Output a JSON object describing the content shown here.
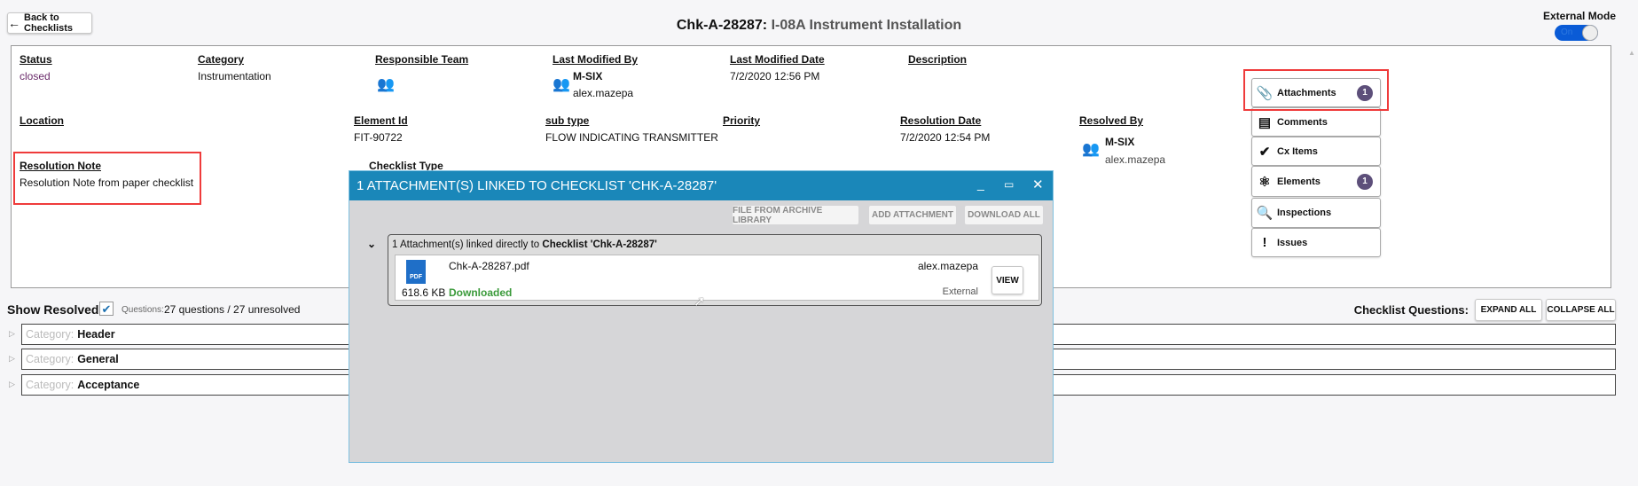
{
  "header": {
    "back_label": "Back to Checklists",
    "title_id": "Chk-A-28287:",
    "title_name": "I-08A Instrument Installation",
    "external_mode_label": "External Mode",
    "external_mode_toggle": "On"
  },
  "details": {
    "status": {
      "label": "Status",
      "value": "closed"
    },
    "category": {
      "label": "Category",
      "value": "Instrumentation"
    },
    "responsible_team": {
      "label": "Responsible Team"
    },
    "last_modified_by": {
      "label": "Last Modified By",
      "team": "M-SIX",
      "user": "alex.mazepa"
    },
    "last_modified_date": {
      "label": "Last Modified Date",
      "value": "7/2/2020 12:56 PM"
    },
    "description": {
      "label": "Description"
    },
    "location": {
      "label": "Location"
    },
    "element_id": {
      "label": "Element Id",
      "value": "FIT-90722"
    },
    "sub_type": {
      "label": "sub type",
      "value": "FLOW INDICATING TRANSMITTER"
    },
    "priority": {
      "label": "Priority"
    },
    "resolution_date": {
      "label": "Resolution Date",
      "value": "7/2/2020 12:54 PM"
    },
    "resolved_by": {
      "label": "Resolved By",
      "team": "M-SIX",
      "user": "alex.mazepa"
    },
    "resolution_note": {
      "label": "Resolution Note",
      "value": "Resolution Note from paper checklist"
    },
    "checklist_type": {
      "label": "Checklist Type"
    }
  },
  "side_buttons": [
    {
      "label": "Attachments",
      "icon": "paperclip-icon",
      "badge": "1"
    },
    {
      "label": "Comments",
      "icon": "comment-icon"
    },
    {
      "label": "Cx Items",
      "icon": "checkmark-icon"
    },
    {
      "label": "Elements",
      "icon": "atom-icon",
      "badge": "1"
    },
    {
      "label": "Inspections",
      "icon": "magnifier-icon"
    },
    {
      "label": "Issues",
      "icon": "exclamation-icon"
    }
  ],
  "dialog": {
    "title": "1 ATTACHMENT(S) LINKED TO CHECKLIST 'CHK-A-28287'",
    "buttons": {
      "archive": "FILE FROM ARCHIVE LIBRARY",
      "add": "ADD ATTACHMENT",
      "download_all": "DOWNLOAD ALL"
    },
    "group_prefix": "1 Attachment(s) linked directly to",
    "group_target": "Checklist 'Chk-A-28287'",
    "attachment": {
      "filename": "Chk-A-28287.pdf",
      "size": "618.6 KB",
      "status": "Downloaded",
      "user": "alex.mazepa",
      "source": "External",
      "view_label": "VIEW",
      "file_type": "PDF"
    }
  },
  "questions": {
    "show_resolved_label": "Show Resolved:",
    "show_resolved_checked": true,
    "questions_label": "Questions:",
    "questions_summary": "27 questions / 27 unresolved",
    "checklist_questions_label": "Checklist Questions:",
    "expand_all": "EXPAND ALL",
    "collapse_all": "COLLAPSE ALL",
    "category_prefix": "Category:",
    "categories": [
      "Header",
      "General",
      "Acceptance"
    ]
  },
  "colors": {
    "accent": "#1a87b9",
    "badge": "#5d4f7a",
    "downloaded": "#3a9a3a",
    "status_closed": "#6a2a6a",
    "highlight": "#ef3b3b"
  }
}
